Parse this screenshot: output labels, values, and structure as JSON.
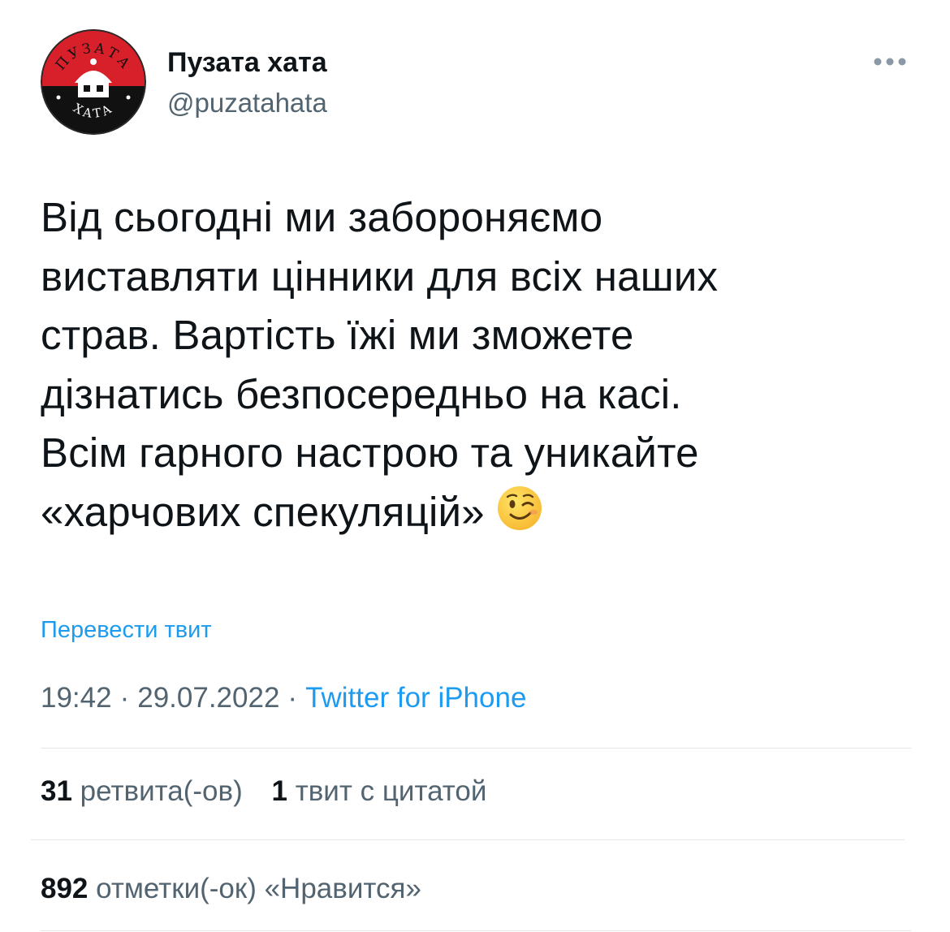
{
  "author": {
    "name": "Пузата хата",
    "handle": "@puzatahata",
    "avatar_text_top": "ПУЗАТА",
    "avatar_text_bottom": "ХАТА"
  },
  "more_icon": "more-horizontal-icon",
  "tweet": {
    "lines": [
      "Від сьогодні ми забороняємо",
      "виставляти цінники для всіх наших",
      "страв. Вартість їжі ми зможете",
      "дізнатись безпосередньо на касі.",
      "Всім гарного настрою та уникайте",
      "«харчових спекуляцій»"
    ],
    "emoji": "winking-face-emoji"
  },
  "translate_label": "Перевести твит",
  "meta": {
    "time": "19:42",
    "date": "29.07.2022",
    "separator": "·",
    "source": "Twitter for iPhone"
  },
  "stats": {
    "retweets_count": "31",
    "retweets_label": "ретвита(-ов)",
    "quotes_count": "1",
    "quotes_label": "твит с цитатой",
    "likes_count": "892",
    "likes_label": "отметки(-ок) «Нравится»"
  },
  "colors": {
    "text_primary": "#0f1419",
    "text_secondary": "#536471",
    "link": "#1d9bf0",
    "divider": "#e1e6ea",
    "avatar_red": "#d8202a",
    "avatar_black": "#111111"
  }
}
